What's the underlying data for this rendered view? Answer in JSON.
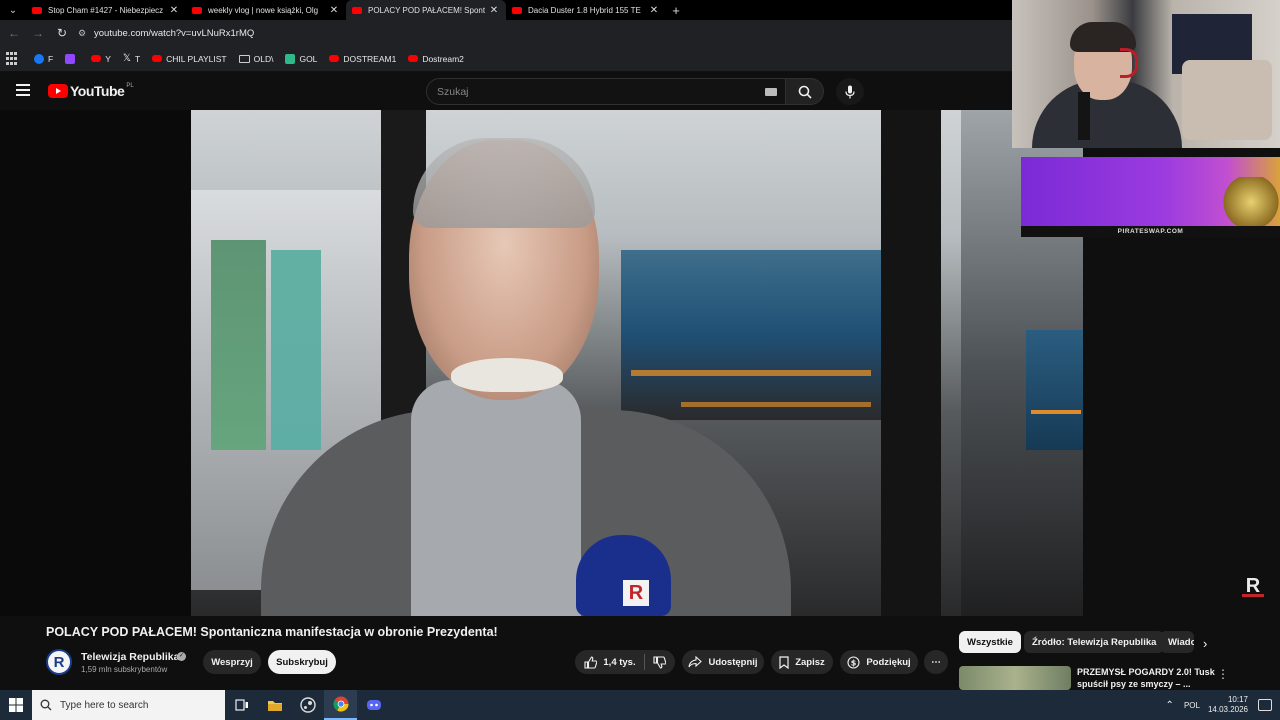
{
  "browser": {
    "tabs": [
      {
        "title": "Stop Cham #1427 - Niebezpiecz",
        "active": false
      },
      {
        "title": "weekly vlog | nowe książki, Olg",
        "active": false
      },
      {
        "title": "POLACY POD PAŁACEM! Spont",
        "active": true
      },
      {
        "title": "Dacia Duster 1.8 Hybrid 155 TE",
        "active": false
      }
    ],
    "url": "youtube.com/watch?v=uvLNuRx1rMQ",
    "bookmarks": [
      {
        "label": "F",
        "color": "#1877f2"
      },
      {
        "label": "",
        "color": "#9146ff"
      },
      {
        "label": "Y",
        "color": "#ff0000"
      },
      {
        "label": "T",
        "color": "#ffffff"
      },
      {
        "label": "CHIL PLAYLIST",
        "color": "#ff0000"
      },
      {
        "label": "OLD\\",
        "color": "#aaaaaa"
      },
      {
        "label": "GOL",
        "color": "#2fb88a"
      },
      {
        "label": "DOSTREAM1",
        "color": "#ff0000"
      },
      {
        "label": "Dostream2",
        "color": "#ff0000"
      }
    ]
  },
  "youtube": {
    "logo": "YouTube",
    "country_code": "PL",
    "search_placeholder": "Szukaj",
    "video": {
      "title": "POLACY POD PAŁACEM! Spontaniczna manifestacja w obronie Prezydenta!",
      "watermark": "R"
    },
    "channel": {
      "name": "Telewizja Republika",
      "avatar_letter": "R",
      "subscribers": "1,59 mln subskrybentów"
    },
    "buttons": {
      "support": "Wesprzyj",
      "subscribe": "Subskrybuj",
      "likes": "1,4 tys.",
      "share": "Udostępnij",
      "save": "Zapisz",
      "thanks": "Podziękuj",
      "more": "⋯"
    },
    "chips": [
      "Wszystkie",
      "Źródło: Telewizja Republika",
      "Wiado"
    ],
    "recommendation": {
      "title": "PRZEMYSŁ POGARDY 2.0! Tusk spuścił psy ze smyczy – ..."
    }
  },
  "overlay": {
    "ad_caption": "PIRATESWAP.COM"
  },
  "taskbar": {
    "search_placeholder": "Type here to search",
    "language": "POL",
    "time": "10:17",
    "date": "14.03.2026"
  }
}
